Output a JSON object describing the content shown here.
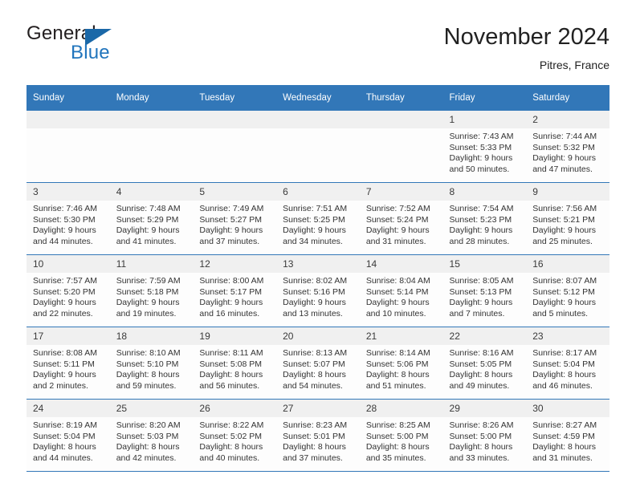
{
  "brand": {
    "name_part1": "General",
    "name_part2": "Blue",
    "flag_icon": "triangle-flag-icon",
    "accent_color": "#2175bd",
    "flag_color": "#1a68a8"
  },
  "header": {
    "title": "November 2024",
    "subtitle": "Pitres, France"
  },
  "calendar": {
    "header_color": "#3277b8",
    "weekday_headers": [
      "Sunday",
      "Monday",
      "Tuesday",
      "Wednesday",
      "Thursday",
      "Friday",
      "Saturday"
    ],
    "weeks": [
      [
        {
          "day": "",
          "empty": true
        },
        {
          "day": "",
          "empty": true
        },
        {
          "day": "",
          "empty": true
        },
        {
          "day": "",
          "empty": true
        },
        {
          "day": "",
          "empty": true
        },
        {
          "day": "1",
          "sunrise": "Sunrise: 7:43 AM",
          "sunset": "Sunset: 5:33 PM",
          "daylight_line1": "Daylight: 9 hours",
          "daylight_line2": "and 50 minutes."
        },
        {
          "day": "2",
          "sunrise": "Sunrise: 7:44 AM",
          "sunset": "Sunset: 5:32 PM",
          "daylight_line1": "Daylight: 9 hours",
          "daylight_line2": "and 47 minutes."
        }
      ],
      [
        {
          "day": "3",
          "sunrise": "Sunrise: 7:46 AM",
          "sunset": "Sunset: 5:30 PM",
          "daylight_line1": "Daylight: 9 hours",
          "daylight_line2": "and 44 minutes."
        },
        {
          "day": "4",
          "sunrise": "Sunrise: 7:48 AM",
          "sunset": "Sunset: 5:29 PM",
          "daylight_line1": "Daylight: 9 hours",
          "daylight_line2": "and 41 minutes."
        },
        {
          "day": "5",
          "sunrise": "Sunrise: 7:49 AM",
          "sunset": "Sunset: 5:27 PM",
          "daylight_line1": "Daylight: 9 hours",
          "daylight_line2": "and 37 minutes."
        },
        {
          "day": "6",
          "sunrise": "Sunrise: 7:51 AM",
          "sunset": "Sunset: 5:25 PM",
          "daylight_line1": "Daylight: 9 hours",
          "daylight_line2": "and 34 minutes."
        },
        {
          "day": "7",
          "sunrise": "Sunrise: 7:52 AM",
          "sunset": "Sunset: 5:24 PM",
          "daylight_line1": "Daylight: 9 hours",
          "daylight_line2": "and 31 minutes."
        },
        {
          "day": "8",
          "sunrise": "Sunrise: 7:54 AM",
          "sunset": "Sunset: 5:23 PM",
          "daylight_line1": "Daylight: 9 hours",
          "daylight_line2": "and 28 minutes."
        },
        {
          "day": "9",
          "sunrise": "Sunrise: 7:56 AM",
          "sunset": "Sunset: 5:21 PM",
          "daylight_line1": "Daylight: 9 hours",
          "daylight_line2": "and 25 minutes."
        }
      ],
      [
        {
          "day": "10",
          "sunrise": "Sunrise: 7:57 AM",
          "sunset": "Sunset: 5:20 PM",
          "daylight_line1": "Daylight: 9 hours",
          "daylight_line2": "and 22 minutes."
        },
        {
          "day": "11",
          "sunrise": "Sunrise: 7:59 AM",
          "sunset": "Sunset: 5:18 PM",
          "daylight_line1": "Daylight: 9 hours",
          "daylight_line2": "and 19 minutes."
        },
        {
          "day": "12",
          "sunrise": "Sunrise: 8:00 AM",
          "sunset": "Sunset: 5:17 PM",
          "daylight_line1": "Daylight: 9 hours",
          "daylight_line2": "and 16 minutes."
        },
        {
          "day": "13",
          "sunrise": "Sunrise: 8:02 AM",
          "sunset": "Sunset: 5:16 PM",
          "daylight_line1": "Daylight: 9 hours",
          "daylight_line2": "and 13 minutes."
        },
        {
          "day": "14",
          "sunrise": "Sunrise: 8:04 AM",
          "sunset": "Sunset: 5:14 PM",
          "daylight_line1": "Daylight: 9 hours",
          "daylight_line2": "and 10 minutes."
        },
        {
          "day": "15",
          "sunrise": "Sunrise: 8:05 AM",
          "sunset": "Sunset: 5:13 PM",
          "daylight_line1": "Daylight: 9 hours",
          "daylight_line2": "and 7 minutes."
        },
        {
          "day": "16",
          "sunrise": "Sunrise: 8:07 AM",
          "sunset": "Sunset: 5:12 PM",
          "daylight_line1": "Daylight: 9 hours",
          "daylight_line2": "and 5 minutes."
        }
      ],
      [
        {
          "day": "17",
          "sunrise": "Sunrise: 8:08 AM",
          "sunset": "Sunset: 5:11 PM",
          "daylight_line1": "Daylight: 9 hours",
          "daylight_line2": "and 2 minutes."
        },
        {
          "day": "18",
          "sunrise": "Sunrise: 8:10 AM",
          "sunset": "Sunset: 5:10 PM",
          "daylight_line1": "Daylight: 8 hours",
          "daylight_line2": "and 59 minutes."
        },
        {
          "day": "19",
          "sunrise": "Sunrise: 8:11 AM",
          "sunset": "Sunset: 5:08 PM",
          "daylight_line1": "Daylight: 8 hours",
          "daylight_line2": "and 56 minutes."
        },
        {
          "day": "20",
          "sunrise": "Sunrise: 8:13 AM",
          "sunset": "Sunset: 5:07 PM",
          "daylight_line1": "Daylight: 8 hours",
          "daylight_line2": "and 54 minutes."
        },
        {
          "day": "21",
          "sunrise": "Sunrise: 8:14 AM",
          "sunset": "Sunset: 5:06 PM",
          "daylight_line1": "Daylight: 8 hours",
          "daylight_line2": "and 51 minutes."
        },
        {
          "day": "22",
          "sunrise": "Sunrise: 8:16 AM",
          "sunset": "Sunset: 5:05 PM",
          "daylight_line1": "Daylight: 8 hours",
          "daylight_line2": "and 49 minutes."
        },
        {
          "day": "23",
          "sunrise": "Sunrise: 8:17 AM",
          "sunset": "Sunset: 5:04 PM",
          "daylight_line1": "Daylight: 8 hours",
          "daylight_line2": "and 46 minutes."
        }
      ],
      [
        {
          "day": "24",
          "sunrise": "Sunrise: 8:19 AM",
          "sunset": "Sunset: 5:04 PM",
          "daylight_line1": "Daylight: 8 hours",
          "daylight_line2": "and 44 minutes."
        },
        {
          "day": "25",
          "sunrise": "Sunrise: 8:20 AM",
          "sunset": "Sunset: 5:03 PM",
          "daylight_line1": "Daylight: 8 hours",
          "daylight_line2": "and 42 minutes."
        },
        {
          "day": "26",
          "sunrise": "Sunrise: 8:22 AM",
          "sunset": "Sunset: 5:02 PM",
          "daylight_line1": "Daylight: 8 hours",
          "daylight_line2": "and 40 minutes."
        },
        {
          "day": "27",
          "sunrise": "Sunrise: 8:23 AM",
          "sunset": "Sunset: 5:01 PM",
          "daylight_line1": "Daylight: 8 hours",
          "daylight_line2": "and 37 minutes."
        },
        {
          "day": "28",
          "sunrise": "Sunrise: 8:25 AM",
          "sunset": "Sunset: 5:00 PM",
          "daylight_line1": "Daylight: 8 hours",
          "daylight_line2": "and 35 minutes."
        },
        {
          "day": "29",
          "sunrise": "Sunrise: 8:26 AM",
          "sunset": "Sunset: 5:00 PM",
          "daylight_line1": "Daylight: 8 hours",
          "daylight_line2": "and 33 minutes."
        },
        {
          "day": "30",
          "sunrise": "Sunrise: 8:27 AM",
          "sunset": "Sunset: 4:59 PM",
          "daylight_line1": "Daylight: 8 hours",
          "daylight_line2": "and 31 minutes."
        }
      ]
    ]
  }
}
